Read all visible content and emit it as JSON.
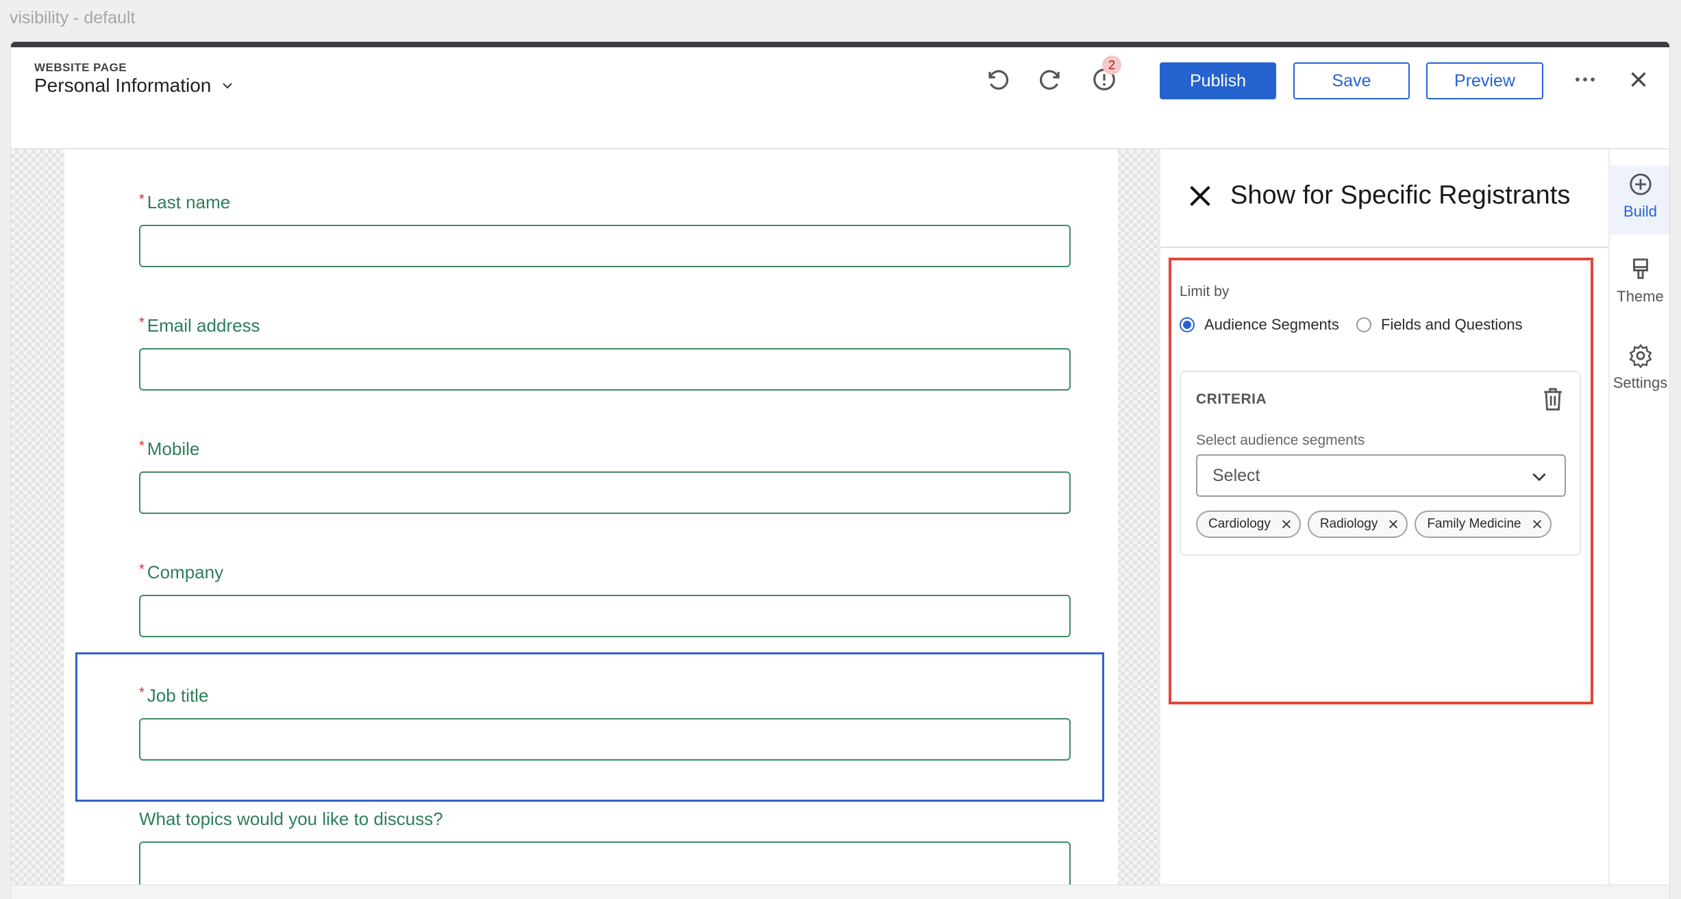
{
  "frame": {
    "label": "visibility - default"
  },
  "header": {
    "kind": "WEBSITE PAGE",
    "page_name": "Personal Information",
    "issues_count": "2",
    "publish_label": "Publish",
    "save_label": "Save",
    "preview_label": "Preview"
  },
  "form": {
    "fields": [
      {
        "label": "Last name",
        "required": true
      },
      {
        "label": "Email address",
        "required": true
      },
      {
        "label": "Mobile",
        "required": true
      },
      {
        "label": "Company",
        "required": true
      },
      {
        "label": "Job title",
        "required": true
      },
      {
        "label": "What topics would you like to discuss?",
        "required": false
      }
    ],
    "required_mark": "*"
  },
  "panel": {
    "title": "Show for Specific Registrants",
    "limit_by_label": "Limit by",
    "options": [
      {
        "label": "Audience Segments",
        "selected": true
      },
      {
        "label": "Fields and Questions",
        "selected": false
      }
    ],
    "criteria": {
      "title": "CRITERIA",
      "select_label": "Select audience segments",
      "select_placeholder": "Select",
      "chips": [
        "Cardiology",
        "Radiology",
        "Family Medicine"
      ]
    }
  },
  "rail": {
    "items": [
      {
        "label": "Build",
        "icon": "plus-circle-icon",
        "active": true
      },
      {
        "label": "Theme",
        "icon": "paint-brush-icon",
        "active": false
      },
      {
        "label": "Settings",
        "icon": "gear-icon",
        "active": false
      }
    ]
  },
  "colors": {
    "primary": "#2563d1",
    "field_label": "#2e7d5b",
    "required": "#d32f2f",
    "highlight": "#e0473a",
    "selection": "#3360c8"
  }
}
